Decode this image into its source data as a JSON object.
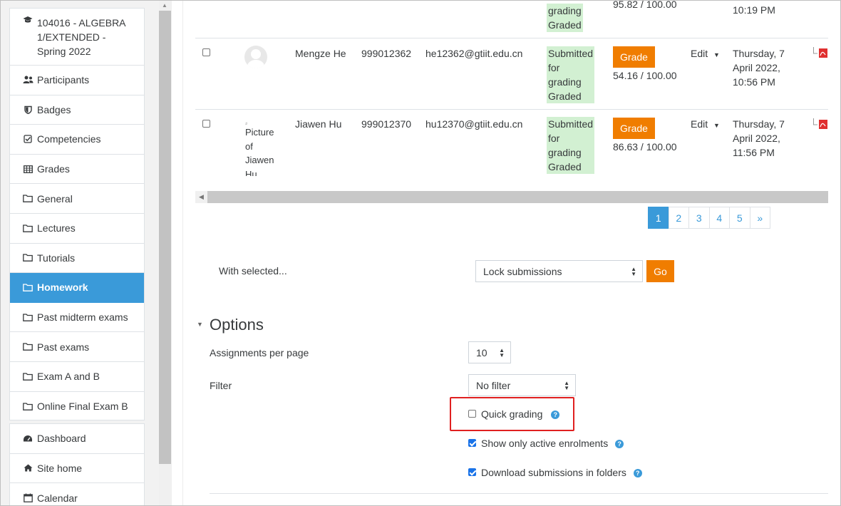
{
  "nav": {
    "course_title": "104016 - ALGEBRA 1/EXTENDED - Spring 2022",
    "items": [
      {
        "label": "Participants",
        "icon": "users-icon"
      },
      {
        "label": "Badges",
        "icon": "shield-icon"
      },
      {
        "label": "Competencies",
        "icon": "checkbox-icon"
      },
      {
        "label": "Grades",
        "icon": "table-icon"
      },
      {
        "label": "General",
        "icon": "folder-icon"
      },
      {
        "label": "Lectures",
        "icon": "folder-icon"
      },
      {
        "label": "Tutorials",
        "icon": "folder-icon"
      },
      {
        "label": "Homework",
        "icon": "folder-icon",
        "active": true
      },
      {
        "label": "Past midterm exams",
        "icon": "folder-icon"
      },
      {
        "label": "Past exams",
        "icon": "folder-icon"
      },
      {
        "label": "Exam A and B",
        "icon": "folder-icon"
      },
      {
        "label": "Online Final Exam B",
        "icon": "folder-icon"
      }
    ],
    "global": [
      {
        "label": "Dashboard",
        "icon": "dashboard-icon"
      },
      {
        "label": "Site home",
        "icon": "home-icon"
      },
      {
        "label": "Calendar",
        "icon": "calendar-icon"
      }
    ]
  },
  "table": {
    "partial_row": {
      "status_lines": [
        "grading",
        "Graded"
      ],
      "score": "95.82 / 100.00",
      "time_last": "10:19 PM"
    },
    "rows": [
      {
        "name": "Mengze He",
        "id_number": "999012362",
        "email": "he12362@gtiit.edu.cn",
        "status_lines": [
          "Submitted",
          "for",
          "grading",
          "Graded"
        ],
        "grade_button": "Grade",
        "score": "54.16 / 100.00",
        "edit": "Edit",
        "modified_lines": [
          "Thursday, 7",
          "April 2022,",
          "10:56 PM"
        ]
      },
      {
        "name": "Jiawen Hu",
        "id_number": "999012370",
        "email": "hu12370@gtiit.edu.cn",
        "avatar_alt_lines": [
          "Picture",
          "of",
          "Jiawen",
          "Hu"
        ],
        "status_lines": [
          "Submitted",
          "for",
          "grading",
          "Graded"
        ],
        "grade_button": "Grade",
        "score": "86.63 / 100.00",
        "edit": "Edit",
        "modified_lines": [
          "Thursday, 7",
          "April 2022,",
          "11:56 PM"
        ]
      }
    ]
  },
  "pagination": {
    "pages": [
      "1",
      "2",
      "3",
      "4",
      "5"
    ],
    "next": "»",
    "current": "1"
  },
  "bulk": {
    "label": "With selected...",
    "action": "Lock submissions",
    "go": "Go"
  },
  "options": {
    "heading": "Options",
    "per_page_label": "Assignments per page",
    "per_page_value": "10",
    "filter_label": "Filter",
    "filter_value": "No filter",
    "quick_grading": {
      "label": "Quick grading",
      "checked": false
    },
    "active_enrolments": {
      "label": "Show only active enrolments",
      "checked": true
    },
    "download_folders": {
      "label": "Download submissions in folders",
      "checked": true
    },
    "help_glyph": "?"
  },
  "colors": {
    "accent": "#3a9ad9",
    "grade_button": "#f07d00",
    "status_bg": "#d2f0d2",
    "highlight": "#e02020"
  }
}
